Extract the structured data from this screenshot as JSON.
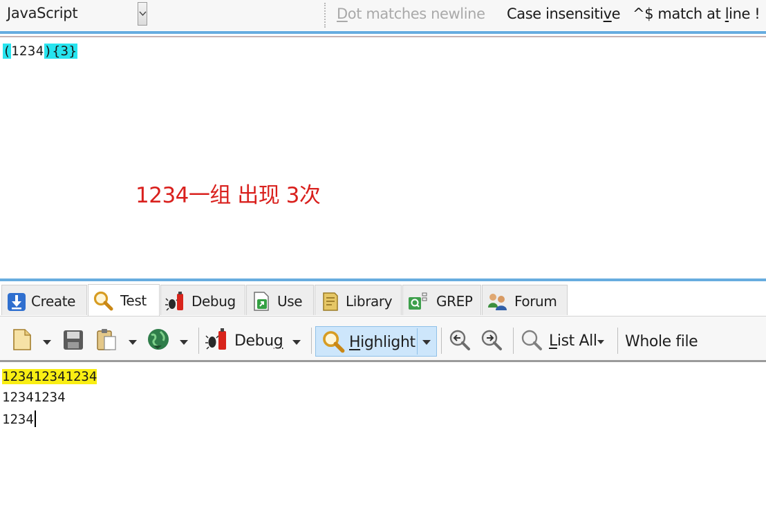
{
  "options": {
    "flavor": "JavaScript",
    "dot_prefix": "D",
    "dot_rest": "ot matches newline",
    "case_pre": "Case insensiti",
    "case_u": "v",
    "case_post": "e",
    "line_pre": "^$ match at ",
    "line_u": "l",
    "line_post": "ine !"
  },
  "regex": {
    "p1": "(",
    "p2": "1234",
    "p3": ")",
    "p4": "{3}"
  },
  "annotation": "1234一组 出现 3次",
  "tabs": [
    "Create",
    "Test",
    "Debug",
    "Use",
    "Library",
    "GREP",
    "Forum"
  ],
  "toolbar": {
    "debug_pre": "Debu",
    "debug_u": "g",
    "highlight_u": "H",
    "highlight_rest": "ighlight",
    "listall_u": "L",
    "listall_rest": "ist All",
    "wholefile": "Whole file"
  },
  "subject": {
    "line1": "123412341234",
    "line2": "12341234",
    "line3": "1234"
  },
  "colors": {
    "regex_highlight": "#27e4ef",
    "match_highlight": "#f9ee13",
    "annotation": "#d9201d",
    "accent": "#67acdf"
  }
}
